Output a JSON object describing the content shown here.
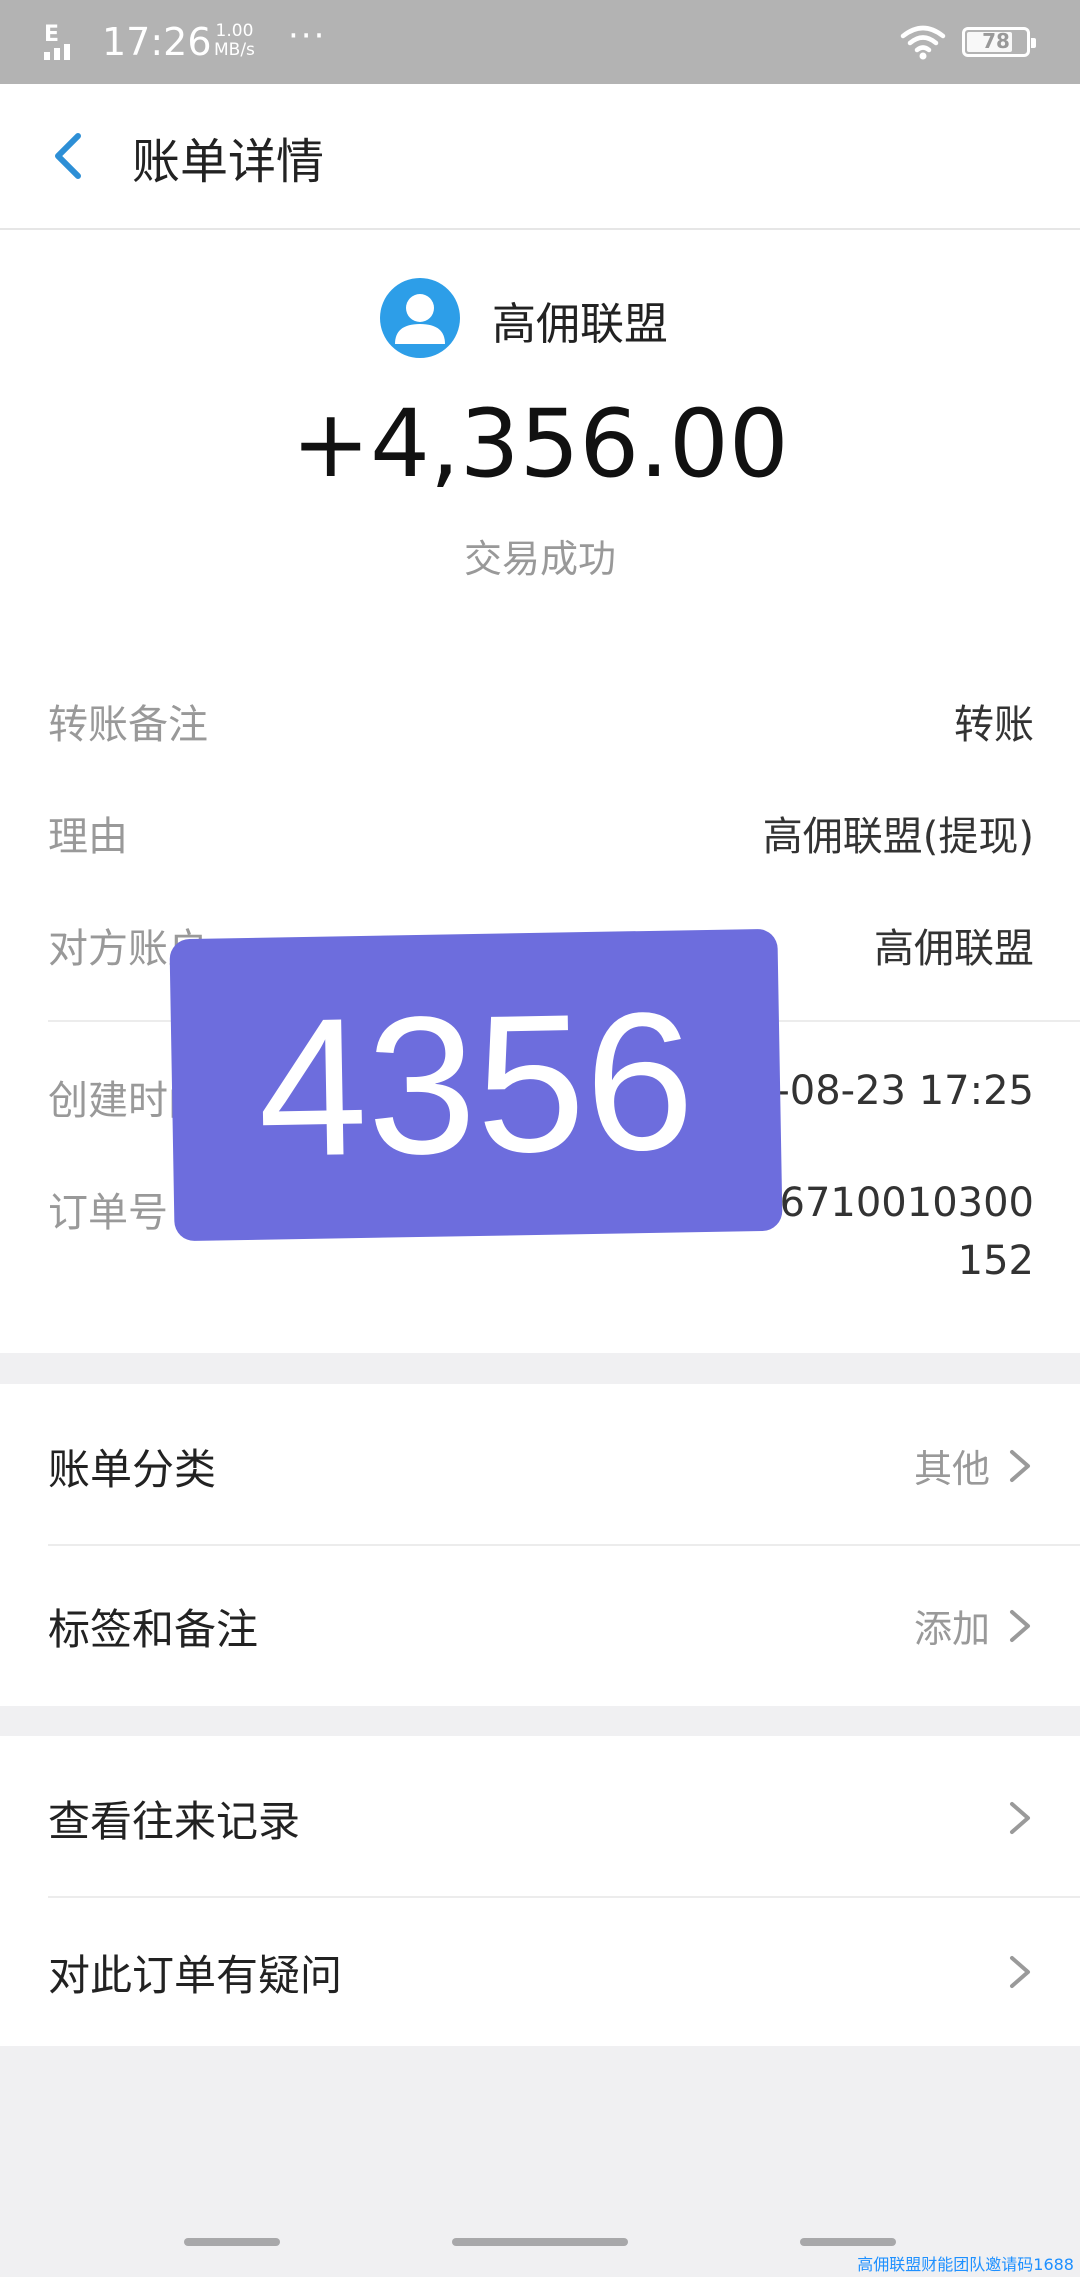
{
  "status_bar": {
    "network": "E",
    "time": "17:26",
    "speed_value": "1.00",
    "speed_unit": "MB/s",
    "more": "···",
    "battery": "78",
    "battery_level": 0.78
  },
  "nav": {
    "title": "账单详情",
    "back_icon": "chevron-left-icon"
  },
  "summary": {
    "payee": "高佣联盟",
    "amount": "+4,356.00",
    "status": "交易成功",
    "avatar_color": "#2d9ee8"
  },
  "details": [
    {
      "label": "转账备注",
      "value": "转账"
    },
    {
      "label": "理由",
      "value": "高佣联盟(提现)"
    },
    {
      "label": "对方账户",
      "value": "高佣联盟"
    },
    {
      "label": "创建时间",
      "value": "2019-08-23 17:25"
    },
    {
      "label": "订单号",
      "value_line1": "20190823110070001506710010300",
      "value_line2": "152"
    }
  ],
  "overlay": {
    "text": "4356",
    "color": "#6d6ddd"
  },
  "menu_group_1": [
    {
      "label": "账单分类",
      "value": "其他"
    },
    {
      "label": "标签和备注",
      "value": "添加"
    }
  ],
  "menu_group_2": [
    {
      "label": "查看往来记录"
    },
    {
      "label": "对此订单有疑问"
    }
  ],
  "footer_watermark": "高佣联盟财能团队邀请码1688"
}
